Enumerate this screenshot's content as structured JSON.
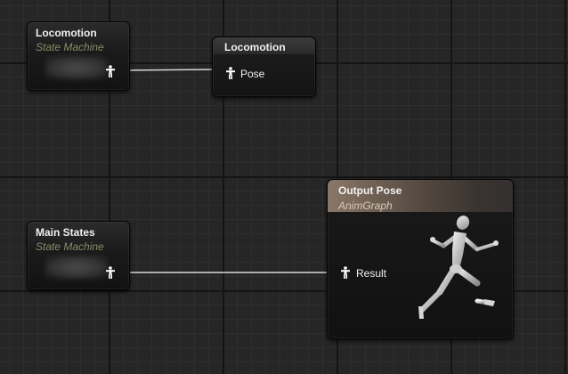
{
  "graph": {
    "nodes": {
      "locomotion_sm": {
        "title": "Locomotion",
        "subtitle": "State Machine"
      },
      "locomotion_result": {
        "title": "Locomotion",
        "pin_label": "Pose"
      },
      "main_states_sm": {
        "title": "Main States",
        "subtitle": "State Machine"
      },
      "output_pose": {
        "title": "Output Pose",
        "subtitle": "AnimGraph",
        "pin_label": "Result"
      }
    },
    "icons": {
      "pose_pin": "pose-pin-icon",
      "preview": "running-mannequin"
    },
    "colors": {
      "background": "#262626",
      "wire": "#d8d8d8",
      "output_header": "#8a7768"
    }
  }
}
